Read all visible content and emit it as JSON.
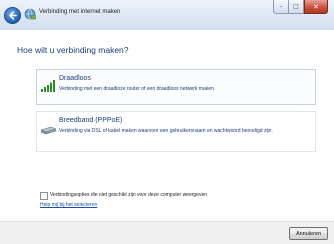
{
  "window": {
    "title": "Verbinding met internet maken",
    "controls": {
      "minimize": "–",
      "maximize": "□",
      "close": "✕"
    }
  },
  "heading": "Hoe wilt u verbinding maken?",
  "options": [
    {
      "title": "Draadloos",
      "description": "Verbinding met een draadloze router of een draadloos netwerk maken",
      "icon": "wireless-signal-icon",
      "highlighted": true
    },
    {
      "title": "Breedband (PPPoE)",
      "description": "Verbinding via DSL of kabel maken waarvoor een gebruikersnaam en wachtwoord benodigd zijn.",
      "icon": "broadband-modem-icon",
      "highlighted": false
    }
  ],
  "checkbox": {
    "label": "Verbindingsopties die niet geschikt zijn voor deze computer weergeven",
    "checked": false
  },
  "help_link": "Help mij bij het selecteren",
  "footer": {
    "cancel_label": "Annuleren"
  }
}
